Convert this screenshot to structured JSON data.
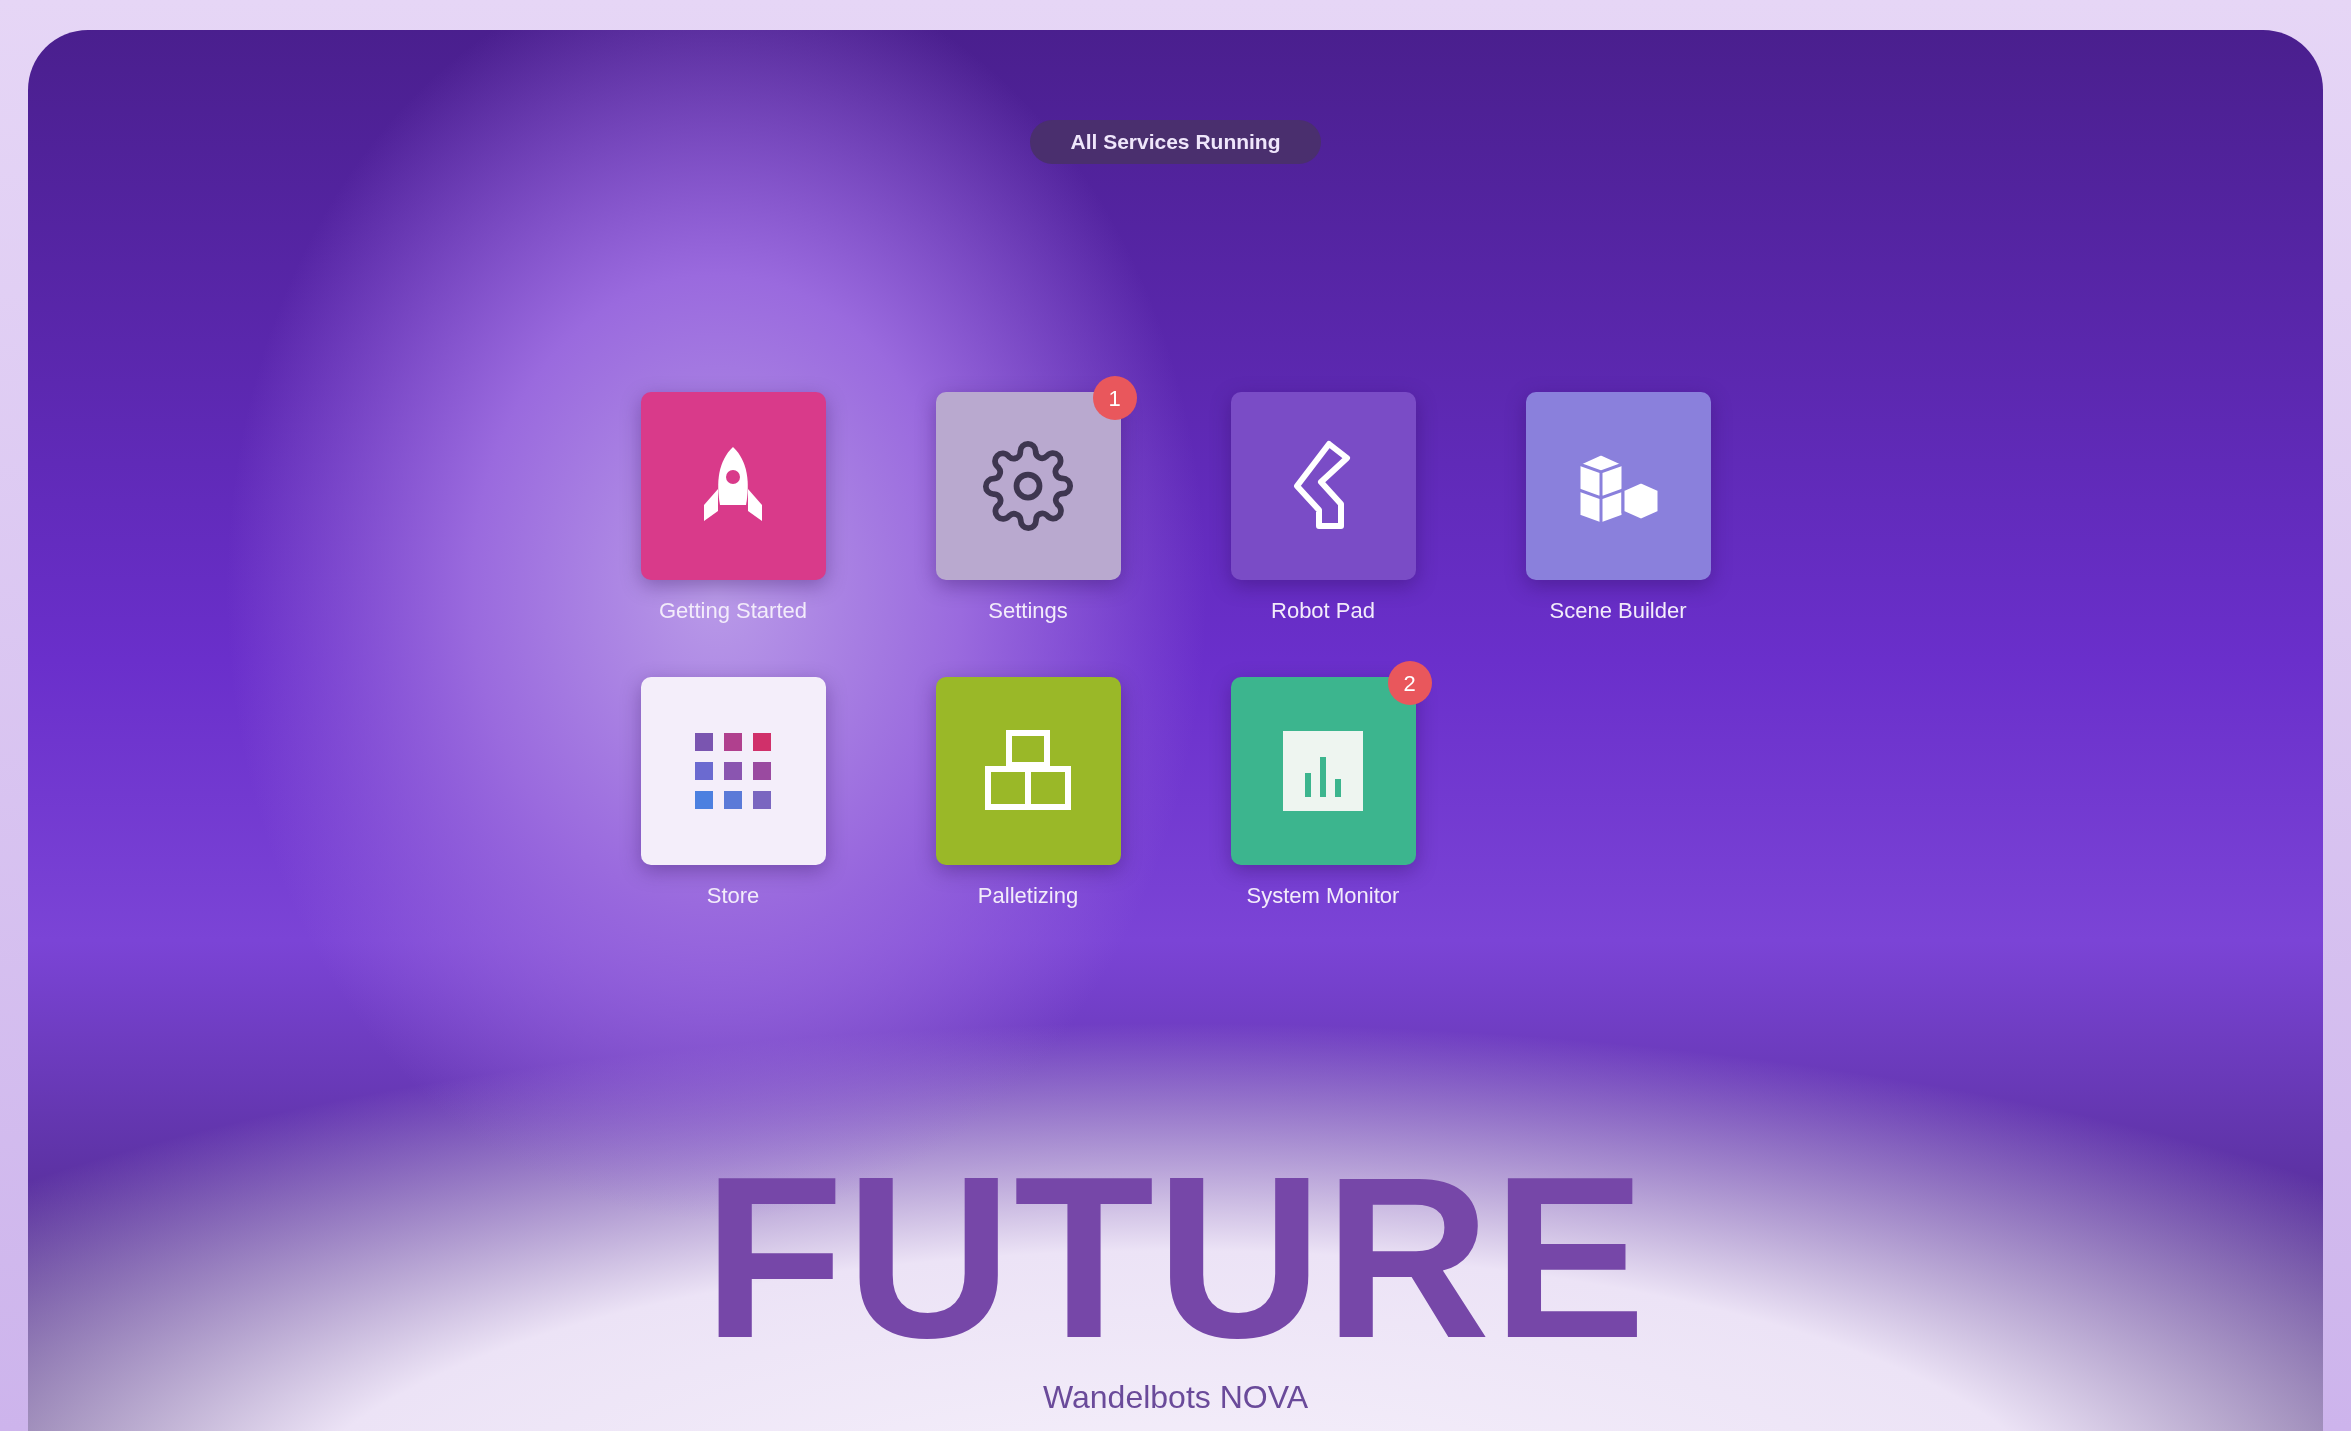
{
  "status_pill": "All Services Running",
  "apps": [
    {
      "label": "Getting Started",
      "kind": "rocket",
      "color": "#d93a8a"
    },
    {
      "label": "Settings",
      "kind": "gear",
      "color": "#b9a9cf",
      "badge": "1"
    },
    {
      "label": "Robot Pad",
      "kind": "robot",
      "color": "#7a4cc6"
    },
    {
      "label": "Scene Builder",
      "kind": "cubes",
      "color": "#8a80dc"
    },
    {
      "label": "Store",
      "kind": "grid",
      "color": "#f4eefa"
    },
    {
      "label": "Palletizing",
      "kind": "boxes",
      "color": "#9ab828"
    },
    {
      "label": "System Monitor",
      "kind": "chart",
      "color": "#3cb58e",
      "badge": "2"
    }
  ],
  "headline": "FUTURE",
  "caption": "Wandelbots NOVA"
}
